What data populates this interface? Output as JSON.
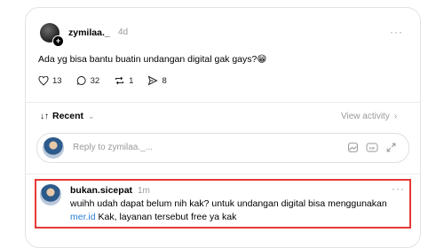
{
  "post": {
    "username": "zymilaa._",
    "time": "4d",
    "text": "Ada yg bisa bantu buatin undangan digital gak gays?",
    "emoji": "😁",
    "more": "···",
    "stats": {
      "likes": "13",
      "comments": "32",
      "reposts": "1",
      "shares": "8"
    }
  },
  "sort": {
    "label": "Recent",
    "view_activity": "View activity"
  },
  "reply": {
    "placeholder": "Reply to zymilaa._..."
  },
  "comment": {
    "username": "bukan.sicepat",
    "time": "1m",
    "more": "···",
    "text_line1": "wuihh udah dapat belum nih kak? untuk undangan digital bisa menggunakan",
    "link": "mer.id",
    "text_line2": " Kak, layanan tersebut free ya kak"
  },
  "colors": {
    "highlight_border": "#e53935",
    "link": "#2a7fd4",
    "muted": "#9a9a9a"
  }
}
